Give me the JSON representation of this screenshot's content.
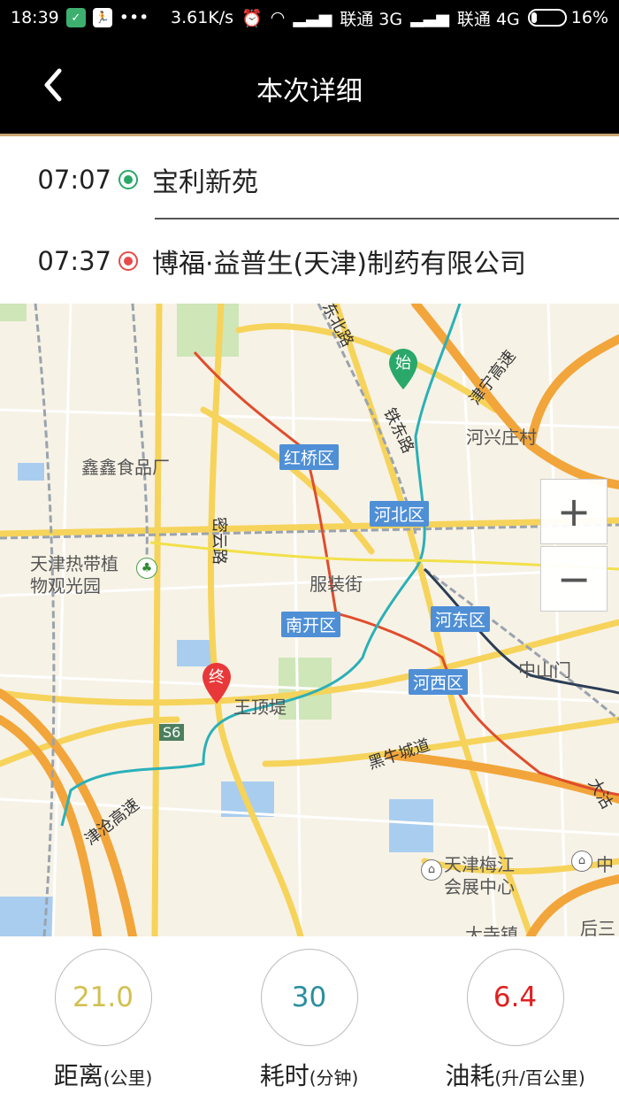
{
  "status_bar": {
    "time": "18:39",
    "speed": "3.61K/s",
    "carrier1": "联通 3G",
    "carrier2": "联通 4G",
    "battery": "16%",
    "battery_level": 0.16
  },
  "header": {
    "title": "本次详细",
    "back_icon": "chevron-left-icon"
  },
  "route": {
    "start": {
      "time": "07:07",
      "place": "宝利新苑",
      "dot_color": "#2aa86a"
    },
    "end": {
      "time": "07:37",
      "place": "博福·益普生(天津)制药有限公司",
      "dot_color": "#e84a4a"
    }
  },
  "map": {
    "pins": {
      "start": "始",
      "end": "终"
    },
    "districts": [
      "红桥区",
      "河北区",
      "南开区",
      "河东区",
      "河西区"
    ],
    "roads": [
      "东北路",
      "铁东路",
      "津宁高速",
      "密云路",
      "黑牛城道",
      "津沧高速",
      "S6",
      "大沽"
    ],
    "places": [
      "河兴庄村",
      "鑫鑫食品厂",
      "天津热带植",
      "物观光园",
      "服装街",
      "中山门",
      "王顶堤",
      "天津梅江",
      "会展中心",
      "大寺镇",
      "后三",
      "中"
    ],
    "zoom_in": "+",
    "zoom_out": "−"
  },
  "stats": {
    "distance": {
      "value": "21.0",
      "label": "距离",
      "unit": "(公里)",
      "color": "#d2c050"
    },
    "duration": {
      "value": "30",
      "label": "耗时",
      "unit": "(分钟)",
      "color": "#2a8fa0"
    },
    "fuel": {
      "value": "6.4",
      "label": "油耗",
      "unit": "(升/百公里)",
      "color": "#e02020"
    }
  }
}
